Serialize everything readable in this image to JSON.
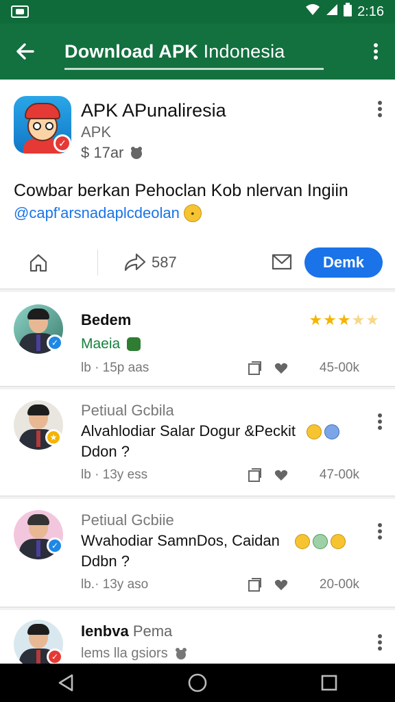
{
  "status_bar": {
    "time": "2:16"
  },
  "app_bar": {
    "title_bold": "Download APK",
    "title_rest": " Indonesia"
  },
  "app": {
    "name": "APK APunaliresia",
    "type": "APK",
    "price": "$ 17ar",
    "description": "Cowbar berkan Pehoclan Kob nlervan Ingiin",
    "tags": "@capf'arsnadaplcdeolan",
    "share_count": "587",
    "primary_button": "Demk"
  },
  "reviews": [
    {
      "name": "Bedem",
      "subtitle": "Maeia",
      "meta": "lb · 15p aas",
      "count": "45-00k",
      "rating": 3,
      "max_rating": 5
    },
    {
      "name": "Petiual Gcbila",
      "text_line1": "Alvahlodiar Salar Dogur &Peckit",
      "text_line2": "Ddon ?",
      "meta": "lb · 13y ess",
      "count": "47-00k"
    },
    {
      "name": "Petiual Gcbiie",
      "text_line1": "Wvahodiar SamnDos, Caidan",
      "text_line2": "Ddbn ?",
      "meta": "lb.· 13y aso",
      "count": "20-00k"
    },
    {
      "name": "Ienbva",
      "name_extra": " Pema",
      "meta": "lems lla gsiors"
    }
  ],
  "colors": {
    "app_bar": "#13703f",
    "accent": "#1a73e8",
    "star": "#f4b400"
  }
}
